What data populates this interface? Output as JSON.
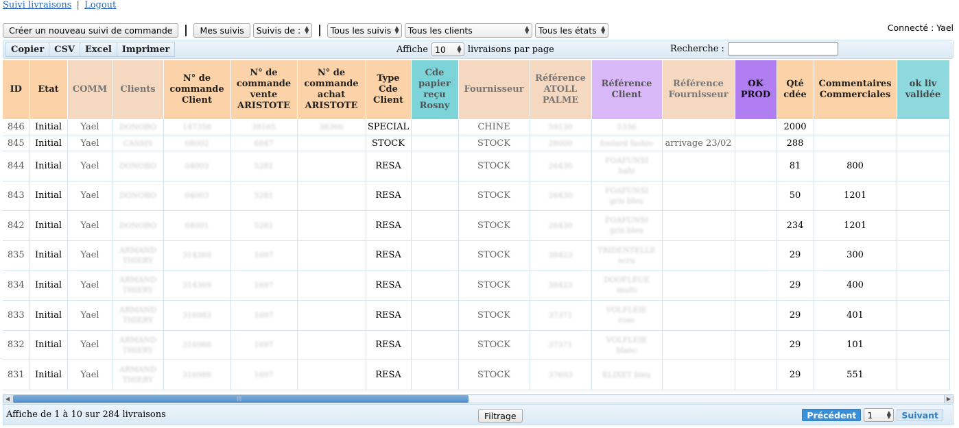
{
  "nav": {
    "link1": "Suivi livraisons",
    "sep": "|",
    "link2": "Logout"
  },
  "controls": {
    "create_btn": "Créer un nouveau suivi de commande",
    "mes_suivis_btn": "Mes suivis",
    "suivis_de_select": "Suivis de :",
    "tous_suivis_select": "Tous les suivis",
    "tous_clients_select": "Tous les clients",
    "tous_etats_select": "Tous les états"
  },
  "connected": "Connecté : Yael",
  "export": {
    "copy": "Copier",
    "csv": "CSV",
    "excel": "Excel",
    "print": "Imprimer"
  },
  "length": {
    "prefix": "Affiche",
    "value": "10",
    "suffix": "livraisons par page"
  },
  "search": {
    "label": "Recherche :",
    "value": ""
  },
  "table": {
    "headers": {
      "id": "ID",
      "etat": "Etat",
      "comm": "COMM",
      "clients": "Clients",
      "num_cmd_client": "N° de commande Client",
      "num_cmd_vente": "N° de commande vente ARISTOTE",
      "num_cmd_achat": "N° de commande achat ARISTOTE",
      "type_cde": "Type Cde Client",
      "cde_papier": "Cde papier reçu Rosny",
      "fournisseur": "Fournisseur",
      "ref_atoll": "Référence ATOLL PALME",
      "ref_client": "Référence Client",
      "ref_fournisseur": "Référence Fournisseur",
      "ok_prod": "OK PROD",
      "qte": "Qté cdée",
      "commentaires": "Commentaires Commerciales",
      "ok_liv": "ok liv validée"
    },
    "rows": [
      {
        "id": "846",
        "etat": "Initial",
        "comm": "Yael",
        "client": "DONOBO",
        "client2": "",
        "cmd_client": "147358",
        "cmd_vente": "38165",
        "cmd_achat": "38366",
        "type": "SPECIAL",
        "fournisseur": "CHINE",
        "ref_atoll": "59130",
        "ref_client": "5336",
        "ref_client2": "",
        "ref_fournisseur": "",
        "qte": "2000",
        "comment": ""
      },
      {
        "id": "845",
        "etat": "Initial",
        "comm": "Yael",
        "client": "CASSIS",
        "client2": "",
        "cmd_client": "08002",
        "cmd_vente": "6847",
        "cmd_achat": "",
        "type": "STOCK",
        "fournisseur": "STOCK",
        "ref_atoll": "28000",
        "ref_client": "foulard fashio",
        "ref_client2": "",
        "ref_fournisseur": "arrivage 23/02",
        "qte": "288",
        "comment": ""
      },
      {
        "id": "844",
        "etat": "Initial",
        "comm": "Yael",
        "client": "DONOBO",
        "client2": "",
        "cmd_client": "04003",
        "cmd_vente": "5281",
        "cmd_achat": "",
        "type": "RESA",
        "fournisseur": "STOCK",
        "ref_atoll": "26430",
        "ref_client": "FOAFUNSI",
        "ref_client2": "bahi",
        "ref_fournisseur": "",
        "qte": "81",
        "comment": "800"
      },
      {
        "id": "843",
        "etat": "Initial",
        "comm": "Yael",
        "client": "DONOBO",
        "client2": "",
        "cmd_client": "04003",
        "cmd_vente": "5281",
        "cmd_achat": "",
        "type": "RESA",
        "fournisseur": "STOCK",
        "ref_atoll": "26430",
        "ref_client": "FOAFUNSI",
        "ref_client2": "gris bleu",
        "ref_fournisseur": "",
        "qte": "50",
        "comment": "1201"
      },
      {
        "id": "842",
        "etat": "Initial",
        "comm": "Yael",
        "client": "DONOBO",
        "client2": "",
        "cmd_client": "04001",
        "cmd_vente": "5281",
        "cmd_achat": "",
        "type": "RESA",
        "fournisseur": "STOCK",
        "ref_atoll": "26430",
        "ref_client": "FOAFUNSI",
        "ref_client2": "gris bleu",
        "ref_fournisseur": "",
        "qte": "234",
        "comment": "1201"
      },
      {
        "id": "835",
        "etat": "Initial",
        "comm": "Yael",
        "client": "ARMAND",
        "client2": "THIERY",
        "cmd_client": "314369",
        "cmd_vente": "1697",
        "cmd_achat": "",
        "type": "RESA",
        "fournisseur": "STOCK",
        "ref_atoll": "38423",
        "ref_client": "TRIDENTELLE",
        "ref_client2": "ecru",
        "ref_fournisseur": "",
        "qte": "29",
        "comment": "300"
      },
      {
        "id": "834",
        "etat": "Initial",
        "comm": "Yael",
        "client": "ARMAND",
        "client2": "THIERY",
        "cmd_client": "314369",
        "cmd_vente": "1697",
        "cmd_achat": "",
        "type": "RESA",
        "fournisseur": "STOCK",
        "ref_atoll": "38423",
        "ref_client": "DOOFLEUE",
        "ref_client2": "multi",
        "ref_fournisseur": "",
        "qte": "29",
        "comment": "400"
      },
      {
        "id": "833",
        "etat": "Initial",
        "comm": "Yael",
        "client": "ARMAND",
        "client2": "THIERY",
        "cmd_client": "316983",
        "cmd_vente": "1697",
        "cmd_achat": "",
        "type": "RESA",
        "fournisseur": "STOCK",
        "ref_atoll": "37371",
        "ref_client": "VOLFLEIE",
        "ref_client2": "rose",
        "ref_fournisseur": "",
        "qte": "29",
        "comment": "401"
      },
      {
        "id": "832",
        "etat": "Initial",
        "comm": "Yael",
        "client": "ARMAND",
        "client2": "THIERY",
        "cmd_client": "316988",
        "cmd_vente": "1697",
        "cmd_achat": "",
        "type": "RESA",
        "fournisseur": "STOCK",
        "ref_atoll": "37371",
        "ref_client": "VOLFLEIE",
        "ref_client2": "blanc",
        "ref_fournisseur": "",
        "qte": "29",
        "comment": "101"
      },
      {
        "id": "831",
        "etat": "Initial",
        "comm": "Yael",
        "client": "ARMAND",
        "client2": "THIERY",
        "cmd_client": "316988",
        "cmd_vente": "1697",
        "cmd_achat": "",
        "type": "RESA",
        "fournisseur": "STOCK",
        "ref_atoll": "37693",
        "ref_client": "ELIXET bleu",
        "ref_client2": "",
        "ref_fournisseur": "",
        "qte": "29",
        "comment": "551"
      }
    ]
  },
  "footer": {
    "info": "Affiche de 1 à 10 sur 284 livraisons",
    "filter_btn": "Filtrage",
    "prev": "Précédent",
    "page": "1",
    "next": "Suivant"
  }
}
